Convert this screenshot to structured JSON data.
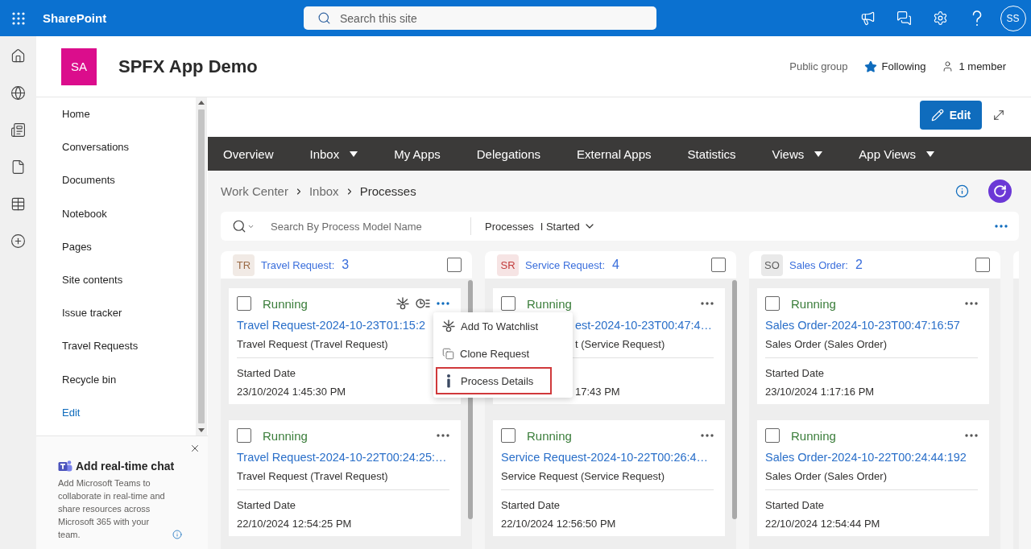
{
  "suite_bar": {
    "app_name": "SharePoint",
    "search": {
      "placeholder": "Search this site"
    },
    "avatar": "SS"
  },
  "site": {
    "logo": "SA",
    "title": "SPFX App Demo",
    "privacy": "Public group",
    "follow": {
      "label": "Following",
      "on": true
    },
    "members": "1 member"
  },
  "site_nav": {
    "items": [
      {
        "label": "Home",
        "kind": "page"
      },
      {
        "label": "Conversations",
        "kind": "page"
      },
      {
        "label": "Documents",
        "kind": "page"
      },
      {
        "label": "Notebook",
        "kind": "page"
      },
      {
        "label": "Pages",
        "kind": "page"
      },
      {
        "label": "Site contents",
        "kind": "page"
      },
      {
        "label": "Issue tracker",
        "kind": "page"
      },
      {
        "label": "Travel Requests",
        "kind": "page"
      },
      {
        "label": "Recycle bin",
        "kind": "page"
      },
      {
        "label": "Edit",
        "kind": "action"
      }
    ]
  },
  "chat_promo": {
    "title": "Add real-time chat",
    "body": "Add Microsoft Teams to collaborate in real-time and share resources across Microsoft 365 with your team."
  },
  "page_toolbar": {
    "edit": "Edit"
  },
  "top_nav": {
    "items": [
      {
        "label": "Overview",
        "has_menu": false
      },
      {
        "label": "Inbox",
        "has_menu": true
      },
      {
        "label": "My Apps",
        "has_menu": false
      },
      {
        "label": "Delegations",
        "has_menu": false
      },
      {
        "label": "External Apps",
        "has_menu": false
      },
      {
        "label": "Statistics",
        "has_menu": false
      },
      {
        "label": "Views",
        "has_menu": true
      },
      {
        "label": "App Views",
        "has_menu": true
      }
    ]
  },
  "breadcrumb": [
    "Work Center",
    "Inbox",
    "Processes"
  ],
  "filter_bar": {
    "search": {
      "placeholder": "Search By Process Model Name"
    },
    "scope": {
      "label": "Processes",
      "value": "I Started"
    }
  },
  "columns": [
    {
      "badge": "TR",
      "color": "#9a6a45",
      "name": "Travel Request:",
      "count": "3",
      "checked": false,
      "scrollbar": true,
      "cards": [
        {
          "checked": false,
          "status": "Running",
          "hovered": true,
          "overlapped": false,
          "title": "Travel Request-2024-10-23T01:15:2",
          "subtitle": "Travel Request (Travel Request)",
          "started_label": "Started Date",
          "started_value": "23/10/2024 1:45:30 PM",
          "menu": {
            "items": [
              {
                "label": "Add To Watchlist",
                "kind": "watch",
                "highlighted": false
              },
              {
                "label": "Clone Request",
                "kind": "clone",
                "highlighted": false
              },
              {
                "label": "Process Details",
                "kind": "details",
                "highlighted": true
              }
            ]
          }
        },
        {
          "checked": false,
          "status": "Running",
          "hovered": false,
          "overlapped": false,
          "title": "Travel Request-2024-10-22T00:24:25:…",
          "subtitle": "Travel Request (Travel Request)",
          "started_label": "Started Date",
          "started_value": "22/10/2024 12:54:25 PM"
        }
      ]
    },
    {
      "badge": "SR",
      "color": "#c23b3b",
      "name": "Service Request:",
      "count": "4",
      "checked": false,
      "scrollbar": true,
      "cards": [
        {
          "checked": false,
          "status": "Running",
          "hovered": false,
          "overlapped": true,
          "title": "est-2024-10-23T00:47:4…",
          "subtitle": "t (Service Request)",
          "started_value": "17:43 PM"
        },
        {
          "checked": false,
          "status": "Running",
          "hovered": false,
          "overlapped": false,
          "title": "Service Request-2024-10-22T00:26:4…",
          "subtitle": "Service Request (Service Request)",
          "started_label": "Started Date",
          "started_value": "22/10/2024 12:56:50 PM"
        }
      ]
    },
    {
      "badge": "SO",
      "color": "#5f5f5f",
      "name": "Sales Order:",
      "count": "2",
      "checked": false,
      "scrollbar": false,
      "cards": [
        {
          "checked": false,
          "status": "Running",
          "hovered": false,
          "overlapped": false,
          "title": "Sales Order-2024-10-23T00:47:16:57",
          "subtitle": "Sales Order (Sales Order)",
          "started_label": "Started Date",
          "started_value": "23/10/2024 1:17:16 PM"
        },
        {
          "checked": false,
          "status": "Running",
          "hovered": false,
          "overlapped": false,
          "title": "Sales Order-2024-10-22T00:24:44:192",
          "subtitle": "Sales Order (Sales Order)",
          "started_label": "Started Date",
          "started_value": "22/10/2024 12:54:44 PM"
        }
      ]
    }
  ]
}
